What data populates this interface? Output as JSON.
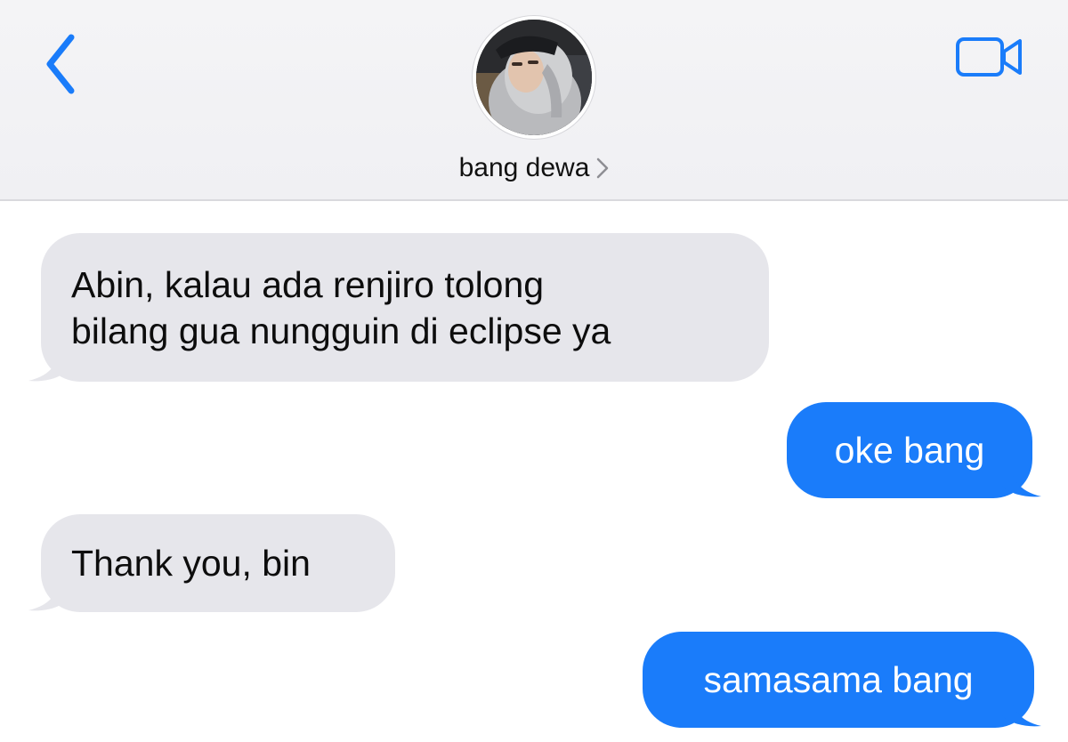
{
  "header": {
    "contact_name": "bang dewa",
    "avatar_icon": "person-photo",
    "back_icon": "chevron-left-icon",
    "video_icon": "video-camera-icon"
  },
  "colors": {
    "accent": "#1a7cfa",
    "incoming_bubble": "#e6e6eb",
    "header_bg": "#f4f4f6"
  },
  "messages": [
    {
      "direction": "incoming",
      "lines": [
        "Abin, kalau ada renjiro tolong",
        "bilang gua nungguin di eclipse ya"
      ]
    },
    {
      "direction": "outgoing",
      "text": "oke bang"
    },
    {
      "direction": "incoming",
      "text": "Thank you, bin"
    },
    {
      "direction": "outgoing",
      "text": "samasama bang"
    }
  ]
}
